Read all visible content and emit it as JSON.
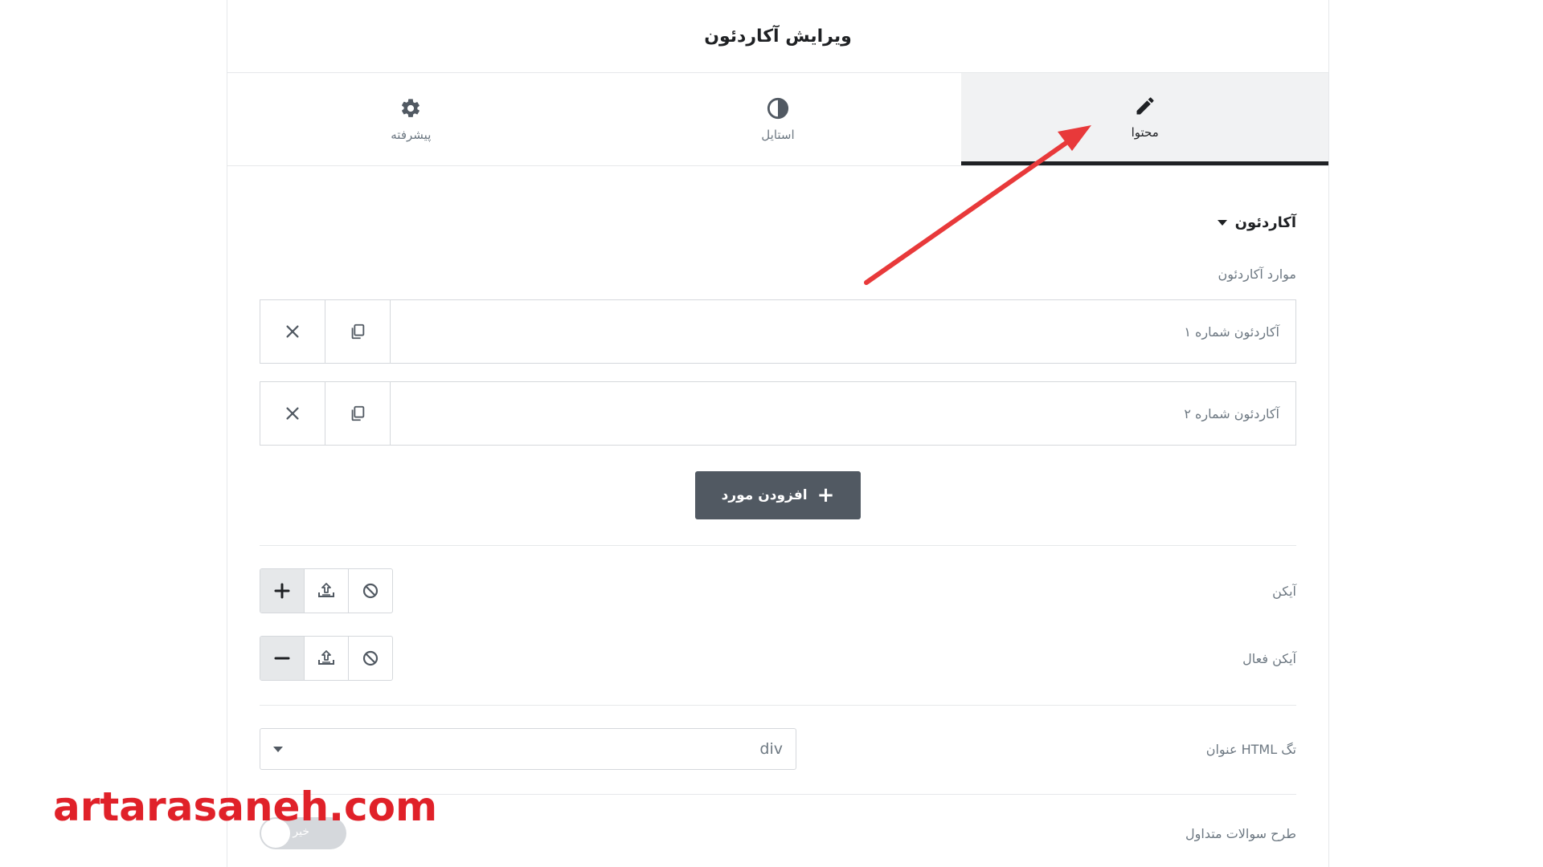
{
  "header": {
    "title": "ویرایش آکاردئون"
  },
  "tabs": [
    {
      "label": "محتوا",
      "icon": "pencil-icon",
      "active": true
    },
    {
      "label": "استایل",
      "icon": "half-circle-icon",
      "active": false
    },
    {
      "label": "پیشرفته",
      "icon": "gear-icon",
      "active": false
    }
  ],
  "section": {
    "title": "آکاردئون"
  },
  "items_field": {
    "label": "موارد آکاردئون",
    "items": [
      {
        "title": "آکاردئون شماره ۱"
      },
      {
        "title": "آکاردئون شماره ۲"
      }
    ],
    "add_label": "افزودن مورد"
  },
  "icon_field": {
    "label": "آیکن",
    "selected_icon": "plus-icon"
  },
  "active_icon_field": {
    "label": "آیکن فعال",
    "selected_icon": "minus-icon"
  },
  "title_tag": {
    "label": "تگ HTML عنوان",
    "value": "div"
  },
  "faq_schema": {
    "label": "طرح سوالات متداول",
    "toggle_text": "خیر"
  },
  "watermark": "artarasaneh.com",
  "colors": {
    "accent_arrow": "#e8393a",
    "button_bg": "#515962",
    "watermark": "#e02129"
  }
}
